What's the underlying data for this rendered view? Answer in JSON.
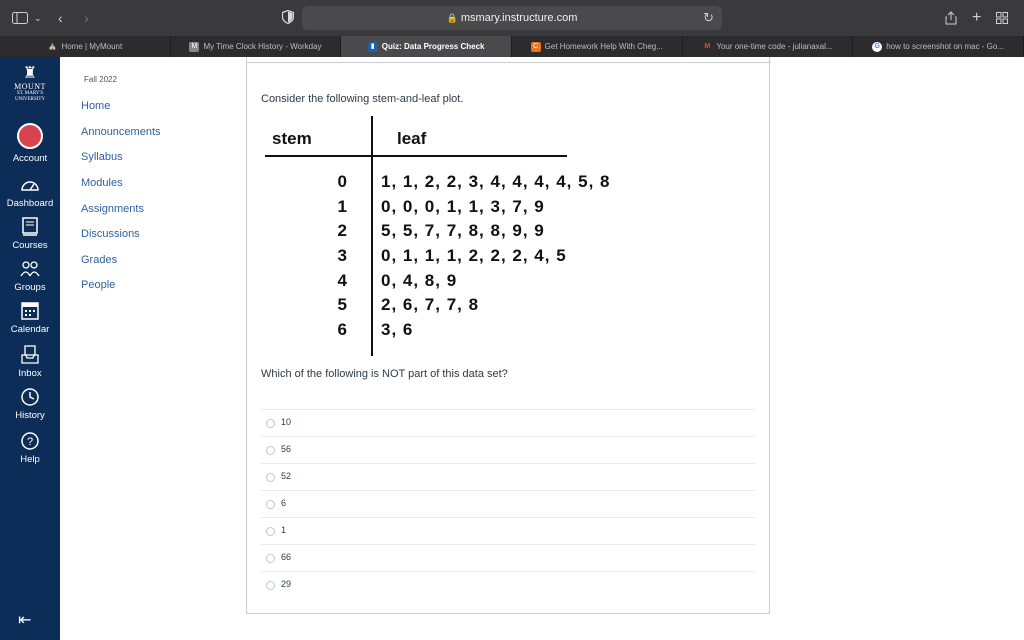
{
  "browser": {
    "url": "msmary.instructure.com",
    "tabs": [
      {
        "label": "Home | MyMount",
        "icon": "mount-tower-icon"
      },
      {
        "label": "My Time Clock History - Workday",
        "icon": "m-workday-icon"
      },
      {
        "label": "Quiz: Data Progress Check",
        "icon": "canvas-quiz-icon"
      },
      {
        "label": "Get Homework Help With Cheg...",
        "icon": "chegg-icon"
      },
      {
        "label": "Your one-time code - julianaxal...",
        "icon": "gmail-icon"
      },
      {
        "label": "how to screenshot on mac - Go...",
        "icon": "google-icon"
      }
    ],
    "active_tab": 2
  },
  "logo": {
    "line1": "MOUNT",
    "line2": "ST. MARY'S",
    "line3": "UNIVERSITY"
  },
  "globalnav": [
    {
      "label": "Account",
      "icon": "account-avatar-icon"
    },
    {
      "label": "Dashboard",
      "icon": "dashboard-icon"
    },
    {
      "label": "Courses",
      "icon": "courses-icon"
    },
    {
      "label": "Groups",
      "icon": "groups-icon"
    },
    {
      "label": "Calendar",
      "icon": "calendar-icon"
    },
    {
      "label": "Inbox",
      "icon": "inbox-icon"
    },
    {
      "label": "History",
      "icon": "history-icon"
    },
    {
      "label": "Help",
      "icon": "help-icon"
    }
  ],
  "coursenav": {
    "term": "Fall 2022",
    "links": [
      "Home",
      "Announcements",
      "Syllabus",
      "Modules",
      "Assignments",
      "Discussions",
      "Grades",
      "People"
    ]
  },
  "quiz": {
    "prompt": "Consider the following stem-and-leaf plot.",
    "stem_header": "stem",
    "leaf_header": "leaf",
    "rows": [
      {
        "stem": "0",
        "leaf": "1, 1, 2, 2, 3, 4, 4, 4, 4, 5, 8"
      },
      {
        "stem": "1",
        "leaf": "0, 0, 0, 1, 1, 3, 7, 9"
      },
      {
        "stem": "2",
        "leaf": "5, 5, 7, 7, 8, 8, 9, 9"
      },
      {
        "stem": "3",
        "leaf": "0, 1, 1, 1, 2, 2, 2, 4, 5"
      },
      {
        "stem": "4",
        "leaf": "0, 4, 8, 9"
      },
      {
        "stem": "5",
        "leaf": "2, 6, 7, 7, 8"
      },
      {
        "stem": "6",
        "leaf": "3, 6"
      }
    ],
    "question": "Which of the following is NOT part of this data set?",
    "options": [
      "10",
      "56",
      "52",
      "6",
      "1",
      "66",
      "29"
    ]
  }
}
